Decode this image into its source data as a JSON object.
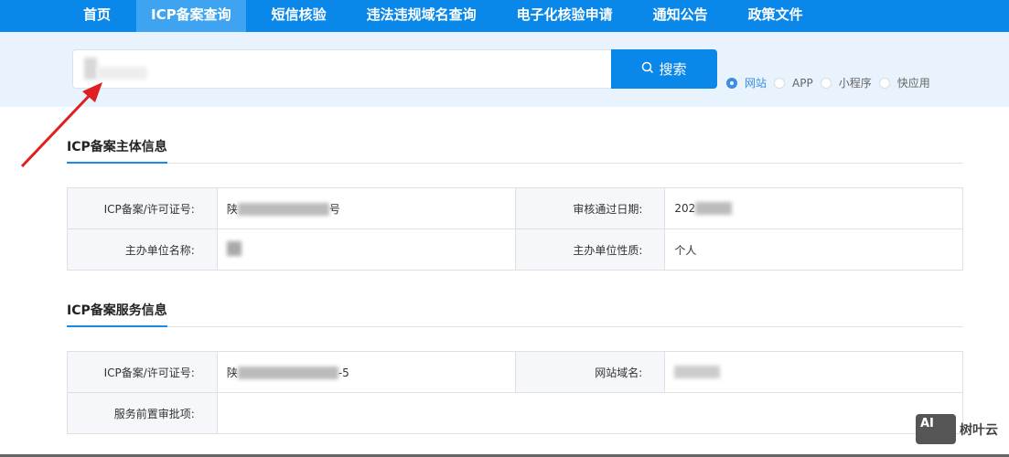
{
  "nav": [
    "首页",
    "ICP备案查询",
    "短信核验",
    "违法违规域名查询",
    "电子化核验申请",
    "通知公告",
    "政策文件"
  ],
  "search": {
    "button": "搜索",
    "options": [
      "网站",
      "APP",
      "小程序",
      "快应用"
    ],
    "selected": "网站"
  },
  "subject": {
    "title": "ICP备案主体信息",
    "rows": [
      {
        "l1": "ICP备案/许可证号:",
        "v1_start": "陕",
        "v1_end": "号",
        "l2": "审核通过日期:",
        "v2": "202"
      },
      {
        "l1": "主办单位名称:",
        "v1_start": "",
        "v1_end": "",
        "l2": "主办单位性质:",
        "v2": "个人"
      }
    ]
  },
  "service": {
    "title": "ICP备案服务信息",
    "rows": [
      {
        "l1": "ICP备案/许可证号:",
        "v1_start": "陕",
        "v1_end": "-5",
        "l2": "网站域名:",
        "v2": ""
      },
      {
        "l1": "服务前置审批项:",
        "v1_start": "",
        "v1_end": "",
        "l2": "",
        "v2": ""
      }
    ]
  },
  "watermark": {
    "logo": "AI",
    "text": "树叶云"
  },
  "colors": {
    "primary": "#0a88ea",
    "arrow": "#e02020"
  }
}
